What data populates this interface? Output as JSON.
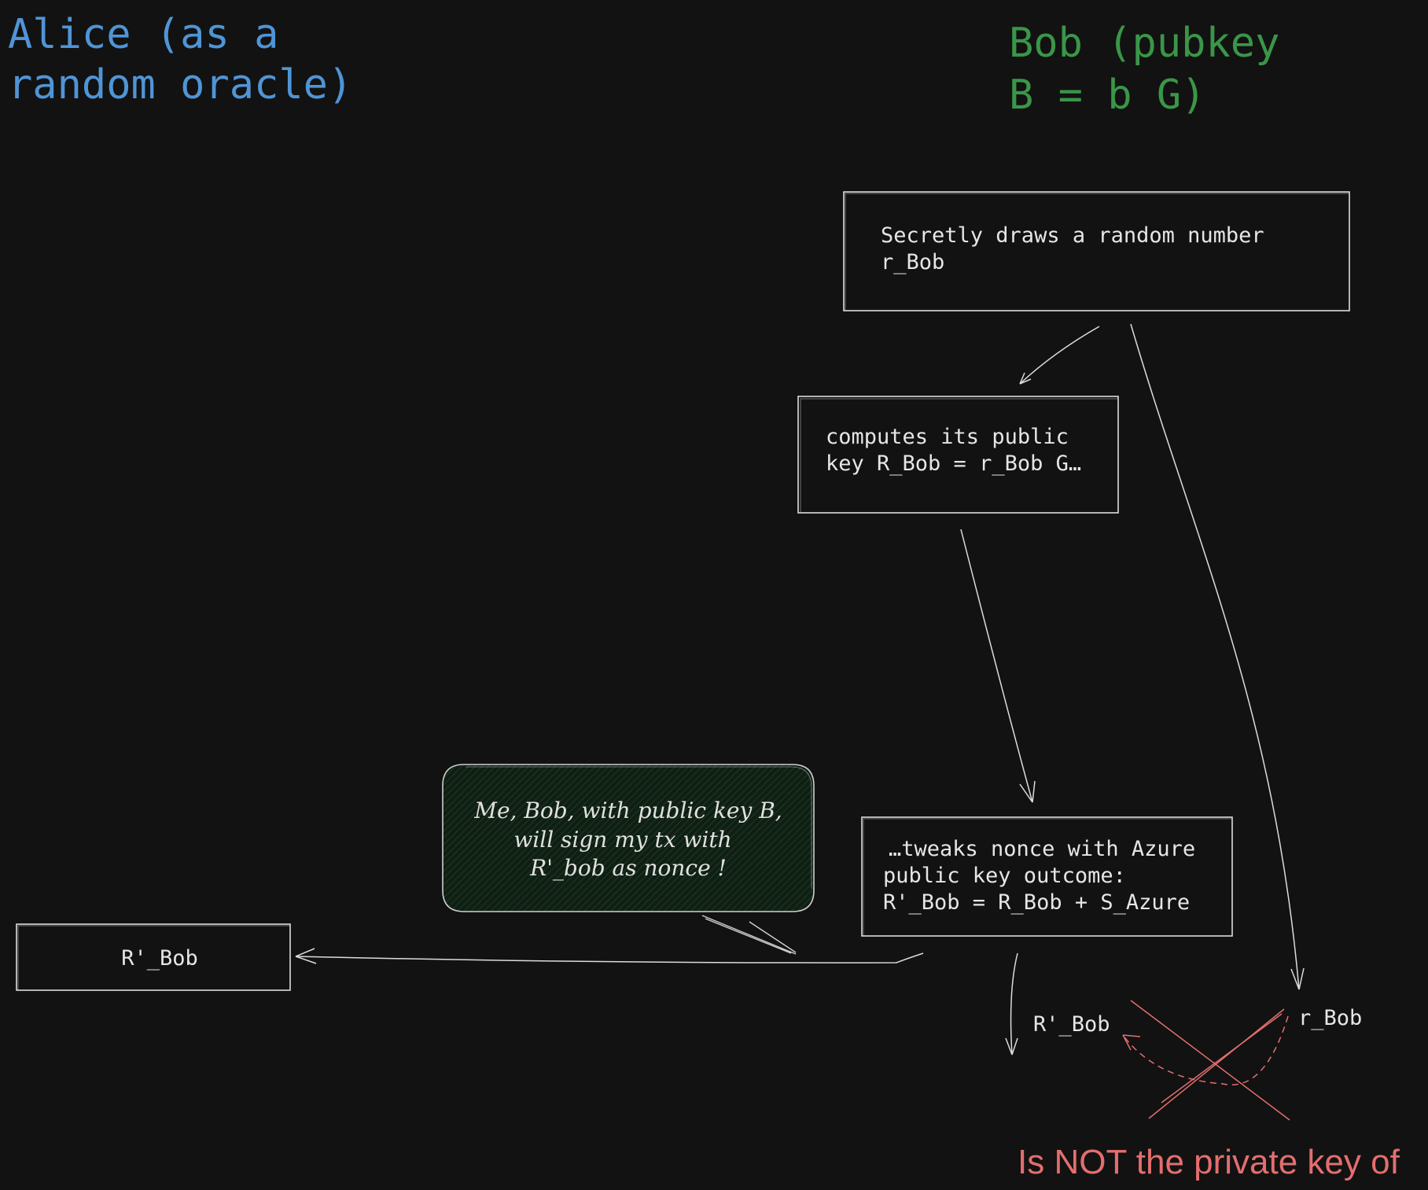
{
  "colors": {
    "background": "#121212",
    "alice": "#4f95d6",
    "bob": "#3a9648",
    "stroke": "#dcdcdc",
    "note_fill": "#102015",
    "warning": "#e46e6e"
  },
  "alice": {
    "title_line1": "Alice (as a",
    "title_line2": "random oracle)"
  },
  "bob": {
    "title_line1": "Bob (pubkey",
    "title_line2": "B = b G)"
  },
  "steps": {
    "draw_nonce": {
      "line1": "Secretly draws a random number",
      "line2": "r_Bob"
    },
    "compute_pubkey": {
      "line1": "computes its public",
      "line2": "key R_Bob = r_Bob G…"
    },
    "tweak": {
      "line1": "…tweaks nonce with Azure",
      "line2": "public key outcome:",
      "line3": "R'_Bob = R_Bob + S_Azure"
    }
  },
  "alice_box": {
    "label": "R'_Bob"
  },
  "note": {
    "line1": "Me, Bob, with public key B,",
    "line2": "will sign my tx with",
    "line3": "R'_bob as nonce !"
  },
  "labels": {
    "r_prime_bob": "R'_Bob",
    "r_bob": "r_Bob"
  },
  "warning": {
    "text": "Is NOT the private key of"
  }
}
